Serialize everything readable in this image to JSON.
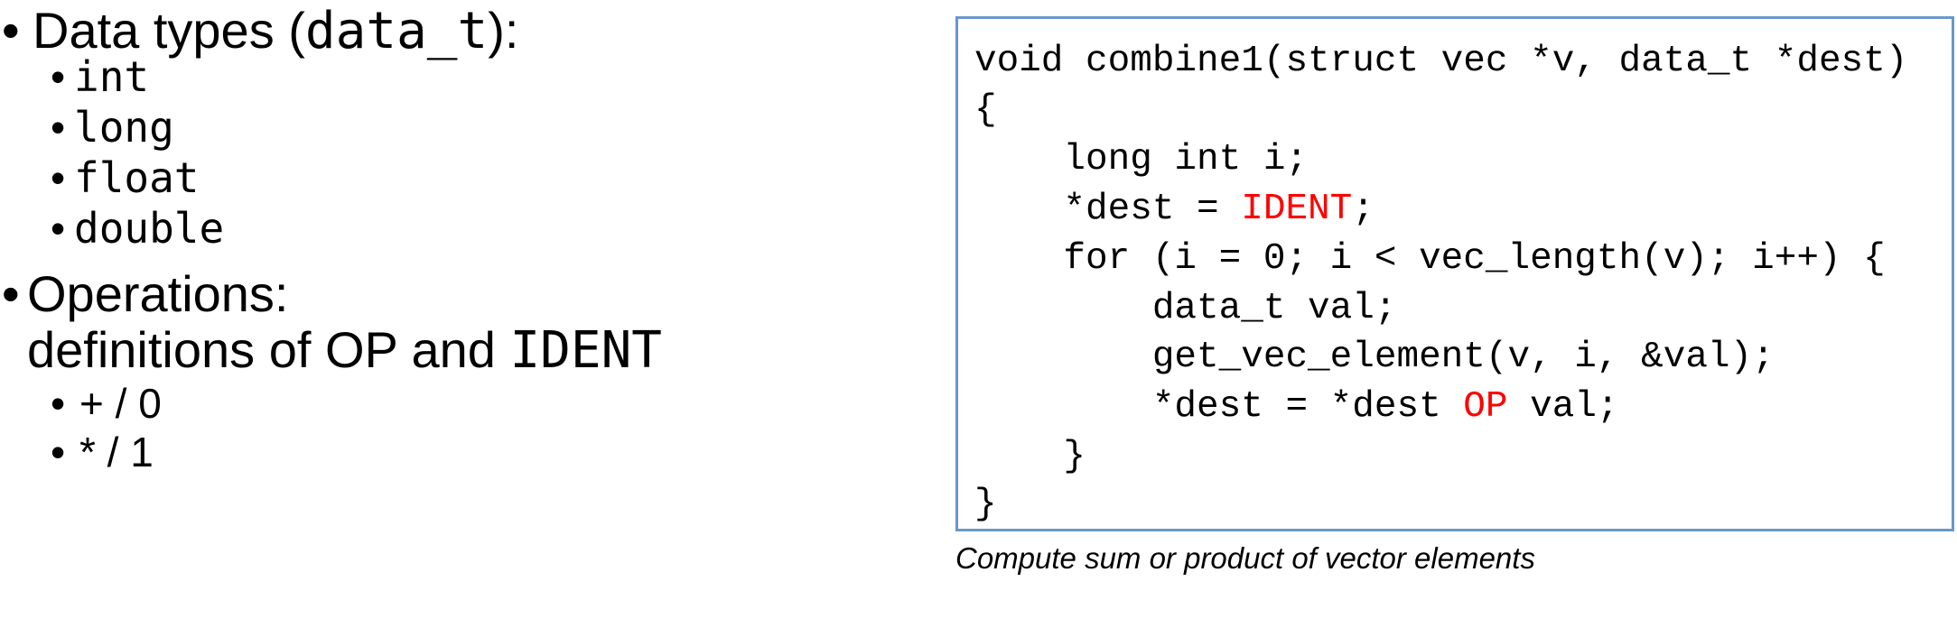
{
  "left_list": {
    "data_types": {
      "label_prefix": "Data types (",
      "label_code": "data_t",
      "label_suffix": "):",
      "items": [
        "int",
        "long",
        "float",
        "double"
      ]
    },
    "operations": {
      "label": "Operations:",
      "line2_prefix": "definitions of OP and ",
      "line2_code": "IDENT",
      "items": [
        "+ / 0",
        "* / 1"
      ]
    },
    "bullet": "•"
  },
  "code": {
    "lines": [
      "void combine1(struct vec *v, data_t *dest)",
      "{",
      "    long int i;",
      "    *dest = ",
      "    for (i = 0; i < vec_length(v); i++) {",
      "        data_t val;",
      "        get_vec_element(v, i, &val);",
      "        *dest = *dest ",
      "    }",
      "}"
    ],
    "ident": "IDENT",
    "ident_tail": ";",
    "op": "OP",
    "op_tail": " val;",
    "highlight_color": "#ff0000",
    "border_color": "#6a97c9"
  },
  "caption": "Compute sum or product of vector elements"
}
